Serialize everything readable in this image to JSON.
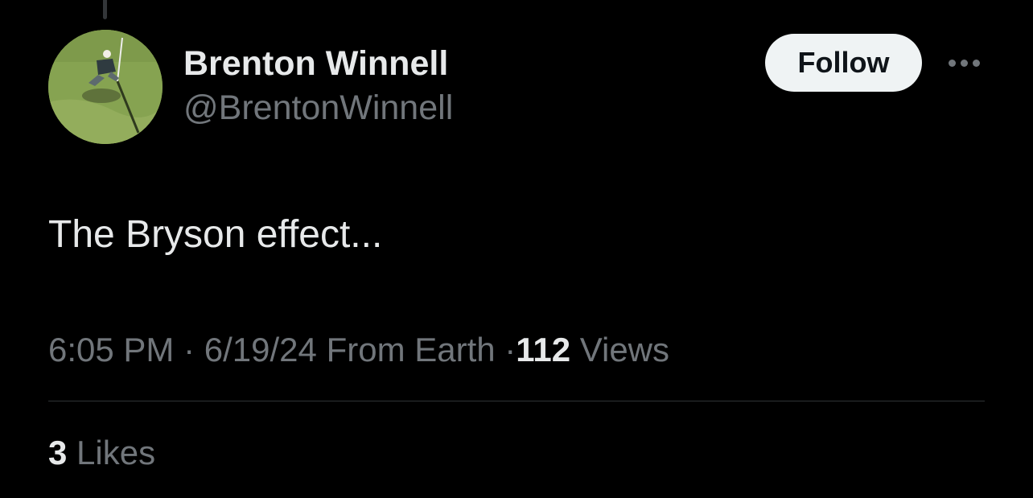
{
  "tweet": {
    "author": {
      "display_name": "Brenton Winnell",
      "handle": "@BrentonWinnell",
      "avatar": "golfer-on-green-photo"
    },
    "follow_label": "Follow",
    "more_icon": "more-horizontal-icon",
    "text": "The Bryson effect...",
    "meta": {
      "time": "6:05 PM",
      "date": "6/19/24",
      "source": "From Earth",
      "separator": "·",
      "views_count": "112",
      "views_label": "Views"
    },
    "likes": {
      "count": "3",
      "label": "Likes"
    }
  },
  "colors": {
    "background": "#000000",
    "primary_text": "#e7e9ea",
    "secondary_text": "#71767b",
    "follow_bg": "#eff3f4",
    "follow_text": "#0f1419",
    "divider": "#2f3336"
  }
}
